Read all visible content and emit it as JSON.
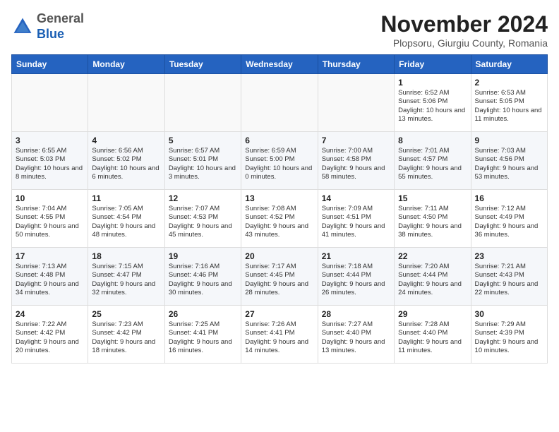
{
  "header": {
    "logo_general": "General",
    "logo_blue": "Blue",
    "month_title": "November 2024",
    "location": "Plopsoru, Giurgiu County, Romania"
  },
  "weekdays": [
    "Sunday",
    "Monday",
    "Tuesday",
    "Wednesday",
    "Thursday",
    "Friday",
    "Saturday"
  ],
  "weeks": [
    [
      {
        "day": "",
        "info": ""
      },
      {
        "day": "",
        "info": ""
      },
      {
        "day": "",
        "info": ""
      },
      {
        "day": "",
        "info": ""
      },
      {
        "day": "",
        "info": ""
      },
      {
        "day": "1",
        "info": "Sunrise: 6:52 AM\nSunset: 5:06 PM\nDaylight: 10 hours and 13 minutes."
      },
      {
        "day": "2",
        "info": "Sunrise: 6:53 AM\nSunset: 5:05 PM\nDaylight: 10 hours and 11 minutes."
      }
    ],
    [
      {
        "day": "3",
        "info": "Sunrise: 6:55 AM\nSunset: 5:03 PM\nDaylight: 10 hours and 8 minutes."
      },
      {
        "day": "4",
        "info": "Sunrise: 6:56 AM\nSunset: 5:02 PM\nDaylight: 10 hours and 6 minutes."
      },
      {
        "day": "5",
        "info": "Sunrise: 6:57 AM\nSunset: 5:01 PM\nDaylight: 10 hours and 3 minutes."
      },
      {
        "day": "6",
        "info": "Sunrise: 6:59 AM\nSunset: 5:00 PM\nDaylight: 10 hours and 0 minutes."
      },
      {
        "day": "7",
        "info": "Sunrise: 7:00 AM\nSunset: 4:58 PM\nDaylight: 9 hours and 58 minutes."
      },
      {
        "day": "8",
        "info": "Sunrise: 7:01 AM\nSunset: 4:57 PM\nDaylight: 9 hours and 55 minutes."
      },
      {
        "day": "9",
        "info": "Sunrise: 7:03 AM\nSunset: 4:56 PM\nDaylight: 9 hours and 53 minutes."
      }
    ],
    [
      {
        "day": "10",
        "info": "Sunrise: 7:04 AM\nSunset: 4:55 PM\nDaylight: 9 hours and 50 minutes."
      },
      {
        "day": "11",
        "info": "Sunrise: 7:05 AM\nSunset: 4:54 PM\nDaylight: 9 hours and 48 minutes."
      },
      {
        "day": "12",
        "info": "Sunrise: 7:07 AM\nSunset: 4:53 PM\nDaylight: 9 hours and 45 minutes."
      },
      {
        "day": "13",
        "info": "Sunrise: 7:08 AM\nSunset: 4:52 PM\nDaylight: 9 hours and 43 minutes."
      },
      {
        "day": "14",
        "info": "Sunrise: 7:09 AM\nSunset: 4:51 PM\nDaylight: 9 hours and 41 minutes."
      },
      {
        "day": "15",
        "info": "Sunrise: 7:11 AM\nSunset: 4:50 PM\nDaylight: 9 hours and 38 minutes."
      },
      {
        "day": "16",
        "info": "Sunrise: 7:12 AM\nSunset: 4:49 PM\nDaylight: 9 hours and 36 minutes."
      }
    ],
    [
      {
        "day": "17",
        "info": "Sunrise: 7:13 AM\nSunset: 4:48 PM\nDaylight: 9 hours and 34 minutes."
      },
      {
        "day": "18",
        "info": "Sunrise: 7:15 AM\nSunset: 4:47 PM\nDaylight: 9 hours and 32 minutes."
      },
      {
        "day": "19",
        "info": "Sunrise: 7:16 AM\nSunset: 4:46 PM\nDaylight: 9 hours and 30 minutes."
      },
      {
        "day": "20",
        "info": "Sunrise: 7:17 AM\nSunset: 4:45 PM\nDaylight: 9 hours and 28 minutes."
      },
      {
        "day": "21",
        "info": "Sunrise: 7:18 AM\nSunset: 4:44 PM\nDaylight: 9 hours and 26 minutes."
      },
      {
        "day": "22",
        "info": "Sunrise: 7:20 AM\nSunset: 4:44 PM\nDaylight: 9 hours and 24 minutes."
      },
      {
        "day": "23",
        "info": "Sunrise: 7:21 AM\nSunset: 4:43 PM\nDaylight: 9 hours and 22 minutes."
      }
    ],
    [
      {
        "day": "24",
        "info": "Sunrise: 7:22 AM\nSunset: 4:42 PM\nDaylight: 9 hours and 20 minutes."
      },
      {
        "day": "25",
        "info": "Sunrise: 7:23 AM\nSunset: 4:42 PM\nDaylight: 9 hours and 18 minutes."
      },
      {
        "day": "26",
        "info": "Sunrise: 7:25 AM\nSunset: 4:41 PM\nDaylight: 9 hours and 16 minutes."
      },
      {
        "day": "27",
        "info": "Sunrise: 7:26 AM\nSunset: 4:41 PM\nDaylight: 9 hours and 14 minutes."
      },
      {
        "day": "28",
        "info": "Sunrise: 7:27 AM\nSunset: 4:40 PM\nDaylight: 9 hours and 13 minutes."
      },
      {
        "day": "29",
        "info": "Sunrise: 7:28 AM\nSunset: 4:40 PM\nDaylight: 9 hours and 11 minutes."
      },
      {
        "day": "30",
        "info": "Sunrise: 7:29 AM\nSunset: 4:39 PM\nDaylight: 9 hours and 10 minutes."
      }
    ]
  ]
}
